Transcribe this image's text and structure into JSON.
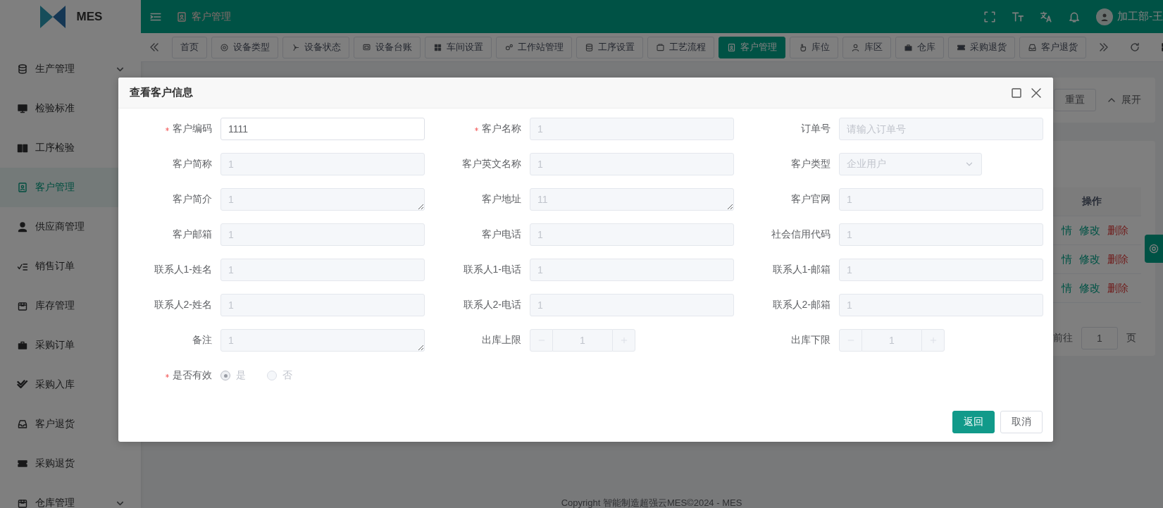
{
  "app": {
    "logo_text": "MES"
  },
  "header": {
    "breadcrumb": "客户管理",
    "user": "加工部-王"
  },
  "tabs": [
    {
      "label": "首页",
      "selected": false
    },
    {
      "label": "设备类型",
      "selected": false
    },
    {
      "label": "设备状态",
      "selected": false
    },
    {
      "label": "设备台账",
      "selected": false
    },
    {
      "label": "车间设置",
      "selected": false
    },
    {
      "label": "工作站管理",
      "selected": false
    },
    {
      "label": "工序设置",
      "selected": false
    },
    {
      "label": "工艺流程",
      "selected": false
    },
    {
      "label": "客户管理",
      "selected": true
    },
    {
      "label": "库位",
      "selected": false
    },
    {
      "label": "库区",
      "selected": false
    },
    {
      "label": "仓库",
      "selected": false
    },
    {
      "label": "采购退货",
      "selected": false
    },
    {
      "label": "客户退货",
      "selected": false
    }
  ],
  "sidebar": {
    "items": [
      {
        "label": "生产管理",
        "selected": false,
        "expandable": true
      },
      {
        "label": "检验标准",
        "selected": false,
        "expandable": false
      },
      {
        "label": "工序检验",
        "selected": false,
        "expandable": false
      },
      {
        "label": "客户管理",
        "selected": true,
        "expandable": false
      },
      {
        "label": "供应商管理",
        "selected": false,
        "expandable": false
      },
      {
        "label": "销售订单",
        "selected": false,
        "expandable": false
      },
      {
        "label": "库存管理",
        "selected": false,
        "expandable": false
      },
      {
        "label": "采购订单",
        "selected": false,
        "expandable": false
      },
      {
        "label": "采购入库",
        "selected": false,
        "expandable": false
      },
      {
        "label": "客户退货",
        "selected": false,
        "expandable": false
      },
      {
        "label": "采购退货",
        "selected": false,
        "expandable": false
      },
      {
        "label": "仓库管理",
        "selected": false,
        "expandable": true
      }
    ]
  },
  "search_card": {
    "reset_button": "重置",
    "toggle": "展开"
  },
  "table": {
    "columns": [
      "操作"
    ],
    "rows": [
      {
        "actions": [
          {
            "label": "情",
            "kind": "view"
          },
          {
            "label": "修改",
            "kind": "edit"
          },
          {
            "label": "删除",
            "kind": "delete"
          }
        ]
      },
      {
        "actions": [
          {
            "label": "情",
            "kind": "view"
          },
          {
            "label": "修改",
            "kind": "edit"
          },
          {
            "label": "删除",
            "kind": "delete"
          }
        ]
      },
      {
        "actions": [
          {
            "label": "情",
            "kind": "view"
          },
          {
            "label": "修改",
            "kind": "edit"
          },
          {
            "label": "删除",
            "kind": "delete"
          }
        ]
      }
    ]
  },
  "pagination": {
    "goto_label": "前往",
    "page": "1",
    "page_suffix": "页"
  },
  "dialog": {
    "title": "查看客户信息",
    "fields": [
      {
        "label": "客户编码",
        "required": true,
        "kind": "text",
        "value": "1111",
        "disabled": false
      },
      {
        "label": "客户名称",
        "required": true,
        "kind": "text",
        "value": "1",
        "disabled": true
      },
      {
        "label": "订单号",
        "required": false,
        "kind": "text",
        "placeholder": "请输入订单号",
        "disabled": true
      },
      {
        "label": "客户简称",
        "required": false,
        "kind": "text",
        "value": "1",
        "disabled": true
      },
      {
        "label": "客户英文名称",
        "required": false,
        "kind": "text",
        "value": "1",
        "disabled": true
      },
      {
        "label": "客户类型",
        "required": false,
        "kind": "select",
        "value": "企业用户",
        "disabled": true
      },
      {
        "label": "客户简介",
        "required": false,
        "kind": "textarea",
        "value": "1",
        "disabled": true
      },
      {
        "label": "客户地址",
        "required": false,
        "kind": "textarea",
        "value": "11",
        "disabled": true
      },
      {
        "label": "客户官网",
        "required": false,
        "kind": "text",
        "value": "1",
        "disabled": true
      },
      {
        "label": "客户邮箱",
        "required": false,
        "kind": "text",
        "value": "1",
        "disabled": true
      },
      {
        "label": "客户电话",
        "required": false,
        "kind": "text",
        "value": "1",
        "disabled": true
      },
      {
        "label": "社会信用代码",
        "required": false,
        "kind": "text",
        "value": "1",
        "disabled": true
      },
      {
        "label": "联系人1-姓名",
        "required": false,
        "kind": "text",
        "value": "1",
        "disabled": true
      },
      {
        "label": "联系人1-电话",
        "required": false,
        "kind": "text",
        "value": "1",
        "disabled": true
      },
      {
        "label": "联系人1-邮箱",
        "required": false,
        "kind": "text",
        "value": "1",
        "disabled": true
      },
      {
        "label": "联系人2-姓名",
        "required": false,
        "kind": "text",
        "value": "1",
        "disabled": true
      },
      {
        "label": "联系人2-电话",
        "required": false,
        "kind": "text",
        "value": "1",
        "disabled": true
      },
      {
        "label": "联系人2-邮箱",
        "required": false,
        "kind": "text",
        "value": "1",
        "disabled": true
      },
      {
        "label": "备注",
        "required": false,
        "kind": "textarea",
        "value": "1",
        "disabled": true
      },
      {
        "label": "出库上限",
        "required": false,
        "kind": "number",
        "value": "1",
        "disabled": true
      },
      {
        "label": "出库下限",
        "required": false,
        "kind": "number",
        "value": "1",
        "disabled": true
      },
      {
        "label": "是否有效",
        "required": true,
        "kind": "radio",
        "disabled": true,
        "options": [
          {
            "label": "是",
            "selected": true
          },
          {
            "label": "否",
            "selected": false
          }
        ]
      }
    ],
    "buttons": [
      {
        "label": "返回",
        "kind": "primary"
      },
      {
        "label": "取消",
        "kind": "default"
      }
    ]
  },
  "footer": {
    "copyright": "Copyright 智能制造超强云MES©2024 - MES"
  }
}
